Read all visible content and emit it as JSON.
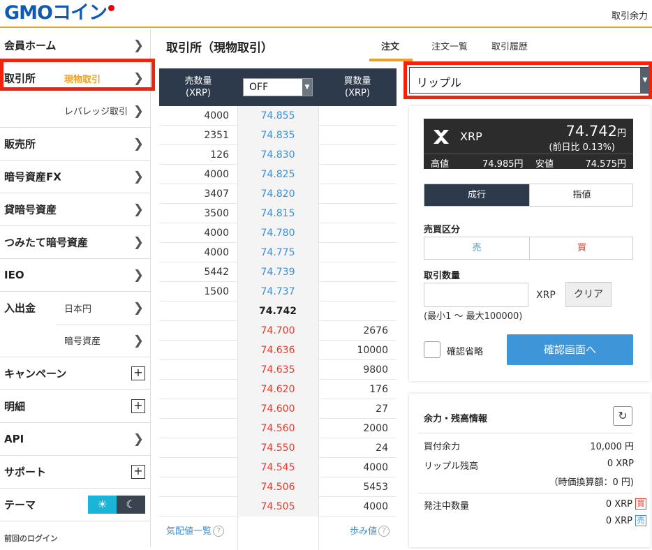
{
  "header": {
    "logo": "GMOコイン",
    "right_link": "取引余力"
  },
  "sidebar": {
    "home": "会員ホーム",
    "exchange": "取引所",
    "exchange_spot": "現物取引",
    "exchange_leverage": "レバレッジ取引",
    "dealer": "販売所",
    "fx": "暗号資産FX",
    "lending": "貸暗号資産",
    "tsumitate": "つみたて暗号資産",
    "ieo": "IEO",
    "deposit": "入出金",
    "deposit_jpy": "日本円",
    "deposit_crypto": "暗号資産",
    "campaign": "キャンペーン",
    "statement": "明細",
    "api": "API",
    "support": "サポート",
    "theme": "テーマ",
    "last_login": "前回のログイン"
  },
  "main": {
    "title": "取引所（現物取引）",
    "tabs": [
      "注文",
      "注文一覧",
      "取引履歴"
    ]
  },
  "orderbook": {
    "sell_header_1": "売数量",
    "sell_header_2": "(XRP)",
    "buy_header_1": "買数量",
    "buy_header_2": "(XRP)",
    "toggle_value": "OFF",
    "asks": [
      {
        "qty": "4000",
        "price": "74.855"
      },
      {
        "qty": "2351",
        "price": "74.835"
      },
      {
        "qty": "126",
        "price": "74.830"
      },
      {
        "qty": "4000",
        "price": "74.825"
      },
      {
        "qty": "3407",
        "price": "74.820"
      },
      {
        "qty": "3500",
        "price": "74.815"
      },
      {
        "qty": "4000",
        "price": "74.780"
      },
      {
        "qty": "4000",
        "price": "74.775"
      },
      {
        "qty": "5442",
        "price": "74.739"
      },
      {
        "qty": "1500",
        "price": "74.737"
      }
    ],
    "mid_price": "74.742",
    "bids": [
      {
        "price": "74.700",
        "qty": "2676"
      },
      {
        "price": "74.636",
        "qty": "10000"
      },
      {
        "price": "74.635",
        "qty": "9800"
      },
      {
        "price": "74.620",
        "qty": "176"
      },
      {
        "price": "74.600",
        "qty": "27"
      },
      {
        "price": "74.560",
        "qty": "2000"
      },
      {
        "price": "74.550",
        "qty": "24"
      },
      {
        "price": "74.545",
        "qty": "4000"
      },
      {
        "price": "74.506",
        "qty": "5453"
      },
      {
        "price": "74.505",
        "qty": "4000"
      }
    ],
    "footer_left": "気配値一覧",
    "footer_right": "歩み値"
  },
  "order": {
    "coin_select": "リップル",
    "ticker_symbol": "XRP",
    "ticker_price": "74.742",
    "ticker_price_unit": "円",
    "ticker_change": "(前日比 0.13%)",
    "high_label": "高値",
    "high_value": "74.985円",
    "low_label": "安値",
    "low_value": "74.575円",
    "type_market": "成行",
    "type_limit": "指値",
    "side_label": "売買区分",
    "side_sell": "売",
    "side_buy": "買",
    "qty_label": "取引数量",
    "qty_value": "",
    "qty_unit": "XRP",
    "clear_label": "クリア",
    "qty_range": "(最小1 〜 最大100000)",
    "skip_confirm_label": "確認省略",
    "confirm_button": "確認画面へ"
  },
  "balance": {
    "title": "余力・残高情報",
    "buy_power_label": "買付余力",
    "buy_power_value": "10,000 円",
    "xrp_balance_label": "リップル残高",
    "xrp_balance_value": "0 XRP",
    "xrp_balance_jpy": "（時価換算額：0 円)",
    "pending_label": "発注中数量",
    "pending_buy_value": "0 XRP",
    "pending_buy_tag": "買",
    "pending_sell_value": "0 XRP",
    "pending_sell_tag": "売"
  },
  "colors": {
    "accent": "#f0a01f",
    "ask": "#3d8fd4",
    "bid": "#e63a2d",
    "highlight": "#f0230f",
    "header_dark": "#2c3a4b"
  }
}
